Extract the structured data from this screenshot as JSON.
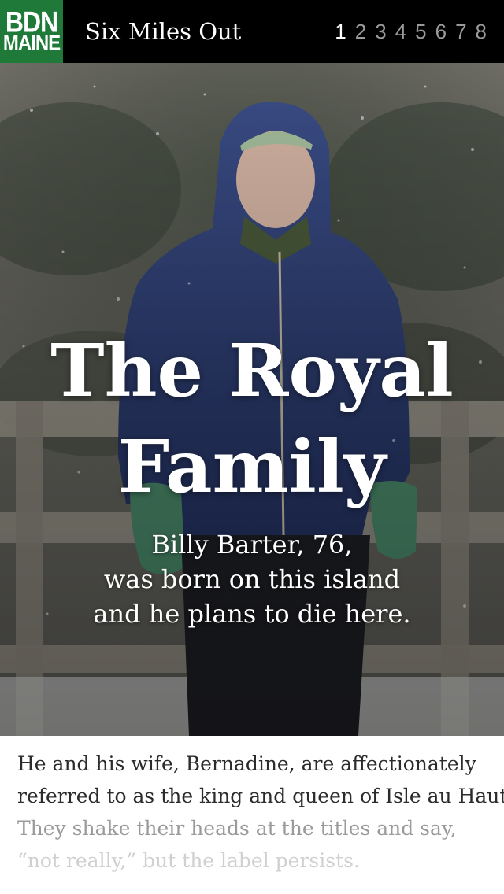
{
  "header": {
    "logo_line1": "BDN",
    "logo_line2": "MAINE",
    "series_title": "Six Miles Out",
    "chapters": [
      "1",
      "2",
      "3",
      "4",
      "5",
      "6",
      "7",
      "8"
    ],
    "active_chapter": "1",
    "colors": {
      "bar": "#000000",
      "logo": "#1f7a3a",
      "active": "#ffffff",
      "inactive": "#9a9a9a"
    }
  },
  "hero": {
    "title_line1": "The Royal",
    "title_line2": "Family",
    "subtitle_line1": "Billy Barter, 76,",
    "subtitle_line2": "was born on this island",
    "subtitle_line3": "and he plans to die here.",
    "image_subject": "man-in-blue-hooded-jacket-in-snow"
  },
  "article": {
    "lines": [
      "He and his wife, Bernadine, are affectionately",
      "referred to as the king and queen of Isle au Haut.",
      "They shake their heads at the titles and say,",
      "“not really,” but the label persists."
    ]
  }
}
